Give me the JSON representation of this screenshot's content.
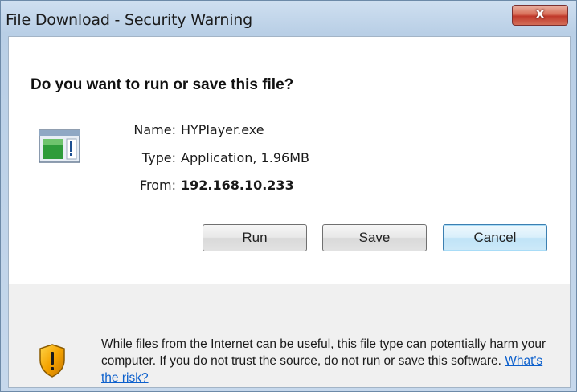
{
  "window": {
    "title": "File Download - Security Warning",
    "close_label": "X"
  },
  "question": "Do you want to run or save this file?",
  "file": {
    "icon": "application-window-icon",
    "name_label": "Name:",
    "name_value": "HYPlayer.exe",
    "type_label": "Type:",
    "type_value": "Application, 1.96MB",
    "from_label": "From:",
    "from_value": "192.168.10.233"
  },
  "buttons": {
    "run": "Run",
    "save": "Save",
    "cancel": "Cancel"
  },
  "warning": {
    "icon": "shield-warning-icon",
    "text": "While files from the Internet can be useful, this file type can potentially harm your computer. If you do not trust the source, do not run or save this software.",
    "link": "What's the risk?"
  }
}
